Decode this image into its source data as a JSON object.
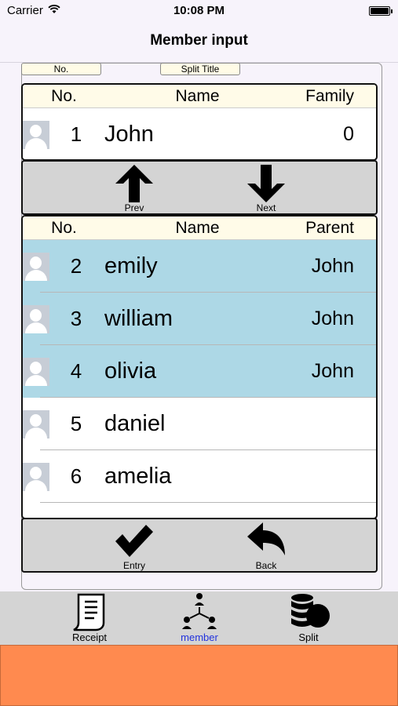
{
  "status_bar": {
    "carrier": "Carrier",
    "time": "10:08 PM"
  },
  "nav": {
    "title": "Member input"
  },
  "form_tabs": {
    "no": "No.",
    "split_title": "Split Title"
  },
  "parent_table": {
    "headers": {
      "no": "No.",
      "name": "Name",
      "family": "Family"
    },
    "rows": [
      {
        "no": "1",
        "name": "John",
        "family": "0"
      }
    ]
  },
  "nav_buttons": {
    "prev": "Prev",
    "next": "Next"
  },
  "child_table": {
    "headers": {
      "no": "No.",
      "name": "Name",
      "parent": "Parent"
    },
    "rows": [
      {
        "no": "2",
        "name": "emily",
        "parent": "John",
        "selected": true
      },
      {
        "no": "3",
        "name": "william",
        "parent": "John",
        "selected": true
      },
      {
        "no": "4",
        "name": "olivia",
        "parent": "John",
        "selected": true
      },
      {
        "no": "5",
        "name": "daniel",
        "parent": "",
        "selected": false
      },
      {
        "no": "6",
        "name": "amelia",
        "parent": "",
        "selected": false
      }
    ]
  },
  "action_buttons": {
    "entry": "Entry",
    "back": "Back"
  },
  "tab_bar": {
    "items": [
      {
        "label": "Receipt",
        "icon": "receipt-icon",
        "active": false
      },
      {
        "label": "member",
        "icon": "member-tree-icon",
        "active": true
      },
      {
        "label": "Split",
        "icon": "split-database-icon",
        "active": false
      }
    ]
  },
  "colors": {
    "selected_row": "#add8e6",
    "active_tab": "#2233dd",
    "bottom_bar": "#ff8a4f"
  }
}
